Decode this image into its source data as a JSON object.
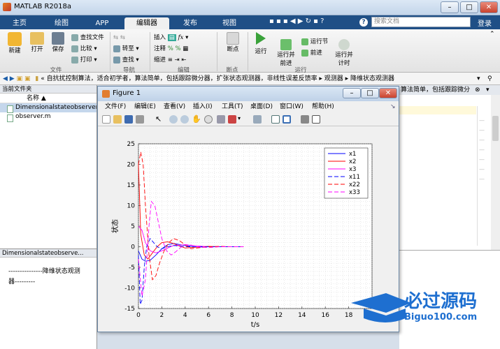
{
  "app": {
    "title": "MATLAB R2018a",
    "signin": "登录",
    "search_placeholder": "搜索文档"
  },
  "tabs": [
    "主页",
    "绘图",
    "APP",
    "编辑器",
    "发布",
    "视图"
  ],
  "ribbon": {
    "file": {
      "new": "新建",
      "open": "打开",
      "save": "保存",
      "find_files": "查找文件",
      "compare": "比较",
      "print": "打印",
      "label": "文件"
    },
    "nav": {
      "goto": "转至",
      "find": "查找",
      "label": "导航"
    },
    "edit": {
      "insert": "插入",
      "comment": "注释",
      "indent": "缩进",
      "label": "编辑"
    },
    "breakpoints": {
      "btn": "断点",
      "label": "断点"
    },
    "run": {
      "run": "运行",
      "run_advance": "运行并\n前进",
      "run_section": "运行节",
      "advance": "前进",
      "run_time": "运行并\n计时",
      "label": "运行"
    }
  },
  "address": {
    "path": "« 自抗扰控制算法，适合初学者，算法简单，包括跟踪微分器，扩张状态观测器，非线性误差反馈率 ▸ 观测器 ▸ 降维状态观测器"
  },
  "current_folder": {
    "title": "当前文件夹",
    "col_name": "名称 ▲",
    "files": [
      "Dimensionalstateobserver.m",
      "observer.m"
    ]
  },
  "details": {
    "title": "Dimensionalstateobserve...",
    "text1": "---------------降维状态观测",
    "text2": "器---------"
  },
  "right_header": "算法简单，包括跟踪微分",
  "figure": {
    "title": "Figure 1",
    "menu": [
      "文件(F)",
      "编辑(E)",
      "查看(V)",
      "插入(I)",
      "工具(T)",
      "桌面(D)",
      "窗口(W)",
      "帮助(H)"
    ]
  },
  "watermark": {
    "text": "必过源码",
    "url": "Biguo100.com"
  },
  "chart_data": {
    "type": "line",
    "xlabel": "t/s",
    "ylabel": "状态",
    "xlim": [
      0,
      20
    ],
    "ylim": [
      -15,
      25
    ],
    "xticks": [
      0,
      2,
      4,
      6,
      8,
      10,
      12,
      14,
      16,
      18
    ],
    "yticks": [
      -15,
      -10,
      -5,
      0,
      5,
      10,
      15,
      20,
      25
    ],
    "grid": true,
    "legend_position": "top-right",
    "series": [
      {
        "name": "x1",
        "color": "#0000ff",
        "dash": "",
        "x": [
          0,
          0.3,
          0.6,
          1.0,
          1.5,
          2,
          2.5,
          3,
          4,
          5,
          6,
          7,
          8
        ],
        "y": [
          -1,
          -3,
          -3.5,
          -3.3,
          -2,
          -0.5,
          0.5,
          0.8,
          0.3,
          -0.1,
          0,
          0,
          0
        ]
      },
      {
        "name": "x2",
        "color": "#ff0000",
        "dash": "",
        "x": [
          0,
          0.2,
          0.5,
          0.8,
          1.2,
          1.6,
          2,
          2.5,
          3,
          3.5,
          4,
          5,
          6,
          7,
          8
        ],
        "y": [
          20,
          3,
          -2,
          -3,
          -1.5,
          0,
          1,
          1.2,
          0.8,
          0.2,
          -0.3,
          -0.1,
          0.1,
          0,
          0
        ]
      },
      {
        "name": "x3",
        "color": "#ff00ff",
        "dash": "",
        "x": [
          0,
          0.3,
          0.6,
          1,
          1.5,
          2,
          2.5,
          3,
          4,
          5,
          6,
          7
        ],
        "y": [
          5,
          4,
          1,
          -1,
          -1.5,
          -1,
          -0.3,
          0.3,
          0.5,
          0.2,
          0,
          0
        ]
      },
      {
        "name": "x11",
        "color": "#0000ff",
        "dash": "6,3",
        "x": [
          0,
          0.15,
          0.3,
          0.5,
          0.7,
          1,
          1.3,
          1.6,
          2,
          2.5,
          3,
          3.5,
          4,
          5,
          6,
          7,
          8,
          9
        ],
        "y": [
          -2,
          -14,
          -13,
          -5,
          0,
          2,
          1,
          0,
          -0.5,
          0,
          0.3,
          0.2,
          0,
          0,
          0,
          0,
          0,
          0
        ]
      },
      {
        "name": "x22",
        "color": "#ff0000",
        "dash": "6,3",
        "x": [
          0,
          0.2,
          0.4,
          0.6,
          0.9,
          1.2,
          1.5,
          1.8,
          2.2,
          2.6,
          3,
          3.5,
          4,
          4.5,
          5,
          6,
          7,
          8,
          9
        ],
        "y": [
          20,
          23,
          20,
          10,
          -2,
          -8,
          -7,
          -4,
          -1,
          1,
          2,
          1.5,
          0.5,
          -0.5,
          -0.3,
          0,
          0.1,
          0,
          0
        ]
      },
      {
        "name": "x33",
        "color": "#ff00ff",
        "dash": "6,3",
        "x": [
          0,
          0.3,
          0.6,
          0.9,
          1.1,
          1.4,
          1.7,
          2,
          2.4,
          2.8,
          3.2,
          3.6,
          4,
          4.5,
          5,
          6,
          7,
          8,
          9
        ],
        "y": [
          -3,
          -12,
          -8,
          5,
          11,
          10,
          6,
          2,
          -1,
          -2,
          -1.2,
          -0.2,
          0.5,
          0.4,
          0,
          -0.2,
          0,
          0,
          0
        ]
      }
    ]
  }
}
